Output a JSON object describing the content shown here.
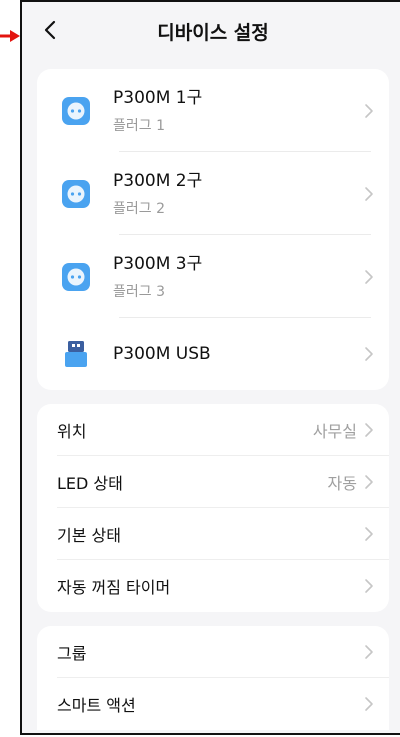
{
  "header": {
    "title": "디바이스 설정"
  },
  "devices": [
    {
      "name": "P300M 1구",
      "sub": "플러그 1",
      "icon": "plug-icon"
    },
    {
      "name": "P300M 2구",
      "sub": "플러그 2",
      "icon": "plug-icon"
    },
    {
      "name": "P300M 3구",
      "sub": "플러그 3",
      "icon": "plug-icon"
    },
    {
      "name": "P300M USB",
      "sub": "",
      "icon": "usb-icon"
    }
  ],
  "settings": [
    {
      "label": "위치",
      "value": "사무실"
    },
    {
      "label": "LED 상태",
      "value": "자동"
    },
    {
      "label": "기본 상태",
      "value": ""
    },
    {
      "label": "자동 꺼짐 타이머",
      "value": ""
    }
  ],
  "more": [
    {
      "label": "그룹"
    },
    {
      "label": "스마트 액션"
    }
  ],
  "colors": {
    "accent": "#4aa3f0",
    "annotation": "#e3140f"
  }
}
